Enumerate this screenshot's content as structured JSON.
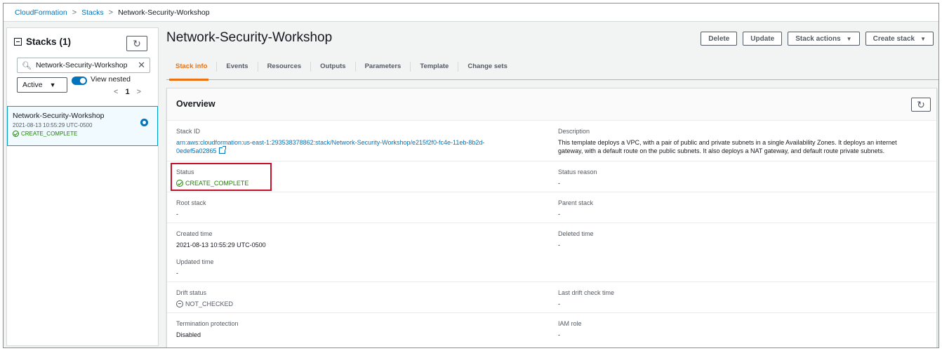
{
  "breadcrumb": {
    "items": [
      "CloudFormation",
      "Stacks"
    ],
    "current": "Network-Security-Workshop"
  },
  "sidebar": {
    "title": "Stacks",
    "count": "(1)",
    "search_value": "Network-Security-Workshop",
    "status_filter": "Active",
    "view_nested_label": "View nested",
    "page_number": "1",
    "stack": {
      "name": "Network-Security-Workshop",
      "time": "2021-08-13 10:55:29 UTC-0500",
      "status": "CREATE_COMPLETE"
    }
  },
  "header": {
    "title": "Network-Security-Workshop",
    "buttons": {
      "delete": "Delete",
      "update": "Update",
      "stack_actions": "Stack actions",
      "create_stack": "Create stack"
    }
  },
  "tabs": [
    "Stack info",
    "Events",
    "Resources",
    "Outputs",
    "Parameters",
    "Template",
    "Change sets"
  ],
  "overview": {
    "title": "Overview",
    "stack_id_label": "Stack ID",
    "stack_id_value_line1": "arn:aws:cloudformation:us-east-1:293538378862:stack/Network-Security-Workshop/e215f2f0-fc4e-11eb-8b2d-",
    "stack_id_value_line2": "0edef5a02865",
    "description_label": "Description",
    "description_line1": "This template deploys a VPC, with a pair of public and private subnets in a single Availability Zones. It deploys an internet",
    "description_line2": "gateway, with a default route on the public subnets. It also deploys a NAT gateway, and default route private subnets.",
    "status_label": "Status",
    "status_value": "CREATE_COMPLETE",
    "status_reason_label": "Status reason",
    "status_reason_value": "-",
    "root_stack_label": "Root stack",
    "root_stack_value": "-",
    "parent_stack_label": "Parent stack",
    "parent_stack_value": "-",
    "created_time_label": "Created time",
    "created_time_value": "2021-08-13 10:55:29 UTC-0500",
    "deleted_time_label": "Deleted time",
    "deleted_time_value": "-",
    "updated_time_label": "Updated time",
    "updated_time_value": "-",
    "drift_status_label": "Drift status",
    "drift_status_value": "NOT_CHECKED",
    "last_drift_label": "Last drift check time",
    "last_drift_value": "-",
    "termination_label": "Termination protection",
    "termination_value": "Disabled",
    "iam_role_label": "IAM role",
    "iam_role_value": "-"
  },
  "colors": {
    "link": "#0073bb",
    "success": "#1d8102",
    "active_tab": "#ec7211",
    "highlight": "#c7102a"
  }
}
